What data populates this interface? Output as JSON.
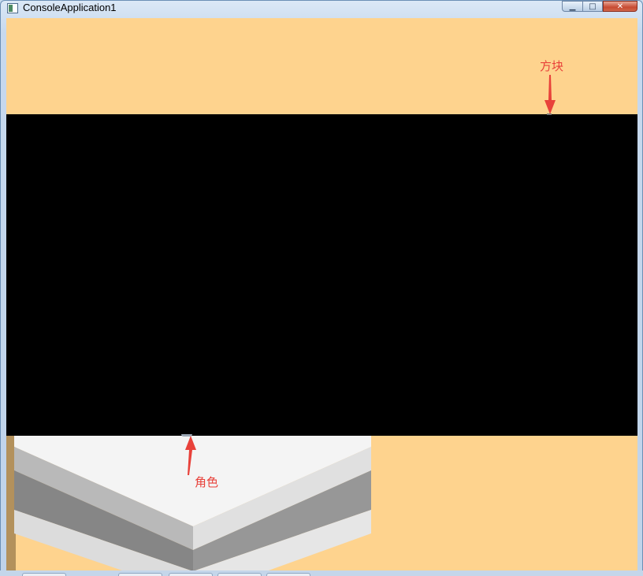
{
  "window": {
    "title": "ConsoleApplication1"
  },
  "caption_buttons": {
    "minimize": "minimize-icon",
    "maximize": "maximize-icon",
    "close": "close-icon"
  },
  "scene": {
    "background_color": "#fed38e",
    "band_color": "#000000",
    "platform_colors": {
      "top": "#f4f4f4",
      "side_left": "#868686",
      "side_right": "#979797",
      "edge_light": "#dcdcdc"
    }
  },
  "annotations": {
    "block_label": "方块",
    "character_label": "角色",
    "color": "#e8413a"
  }
}
